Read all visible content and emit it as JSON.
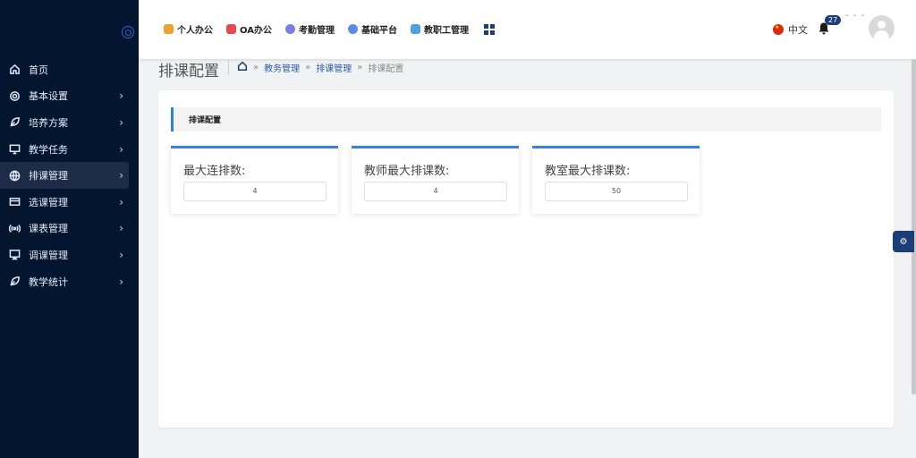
{
  "sidebar": {
    "items": [
      {
        "label": "首页",
        "icon": "home-icon",
        "has_children": false
      },
      {
        "label": "基本设置",
        "icon": "gear-icon",
        "has_children": true
      },
      {
        "label": "培养方案",
        "icon": "leaf-icon",
        "has_children": true
      },
      {
        "label": "教学任务",
        "icon": "monitor-icon",
        "has_children": true
      },
      {
        "label": "排课管理",
        "icon": "globe-icon",
        "has_children": true,
        "active": true
      },
      {
        "label": "选课管理",
        "icon": "card-icon",
        "has_children": true
      },
      {
        "label": "课表管理",
        "icon": "broadcast-icon",
        "has_children": true
      },
      {
        "label": "调课管理",
        "icon": "screen-icon",
        "has_children": true
      },
      {
        "label": "教学统计",
        "icon": "leaf-icon",
        "has_children": true
      }
    ],
    "chevron": "›"
  },
  "topnav": {
    "items": [
      {
        "label": "个人办公",
        "color": "#f0a030"
      },
      {
        "label": "OA办公",
        "color": "#e8484f"
      },
      {
        "label": "考勤管理",
        "color": "#7a7fe0"
      },
      {
        "label": "基础平台",
        "color": "#5b8de0"
      },
      {
        "label": "教职工管理",
        "color": "#4f9fe3"
      }
    ],
    "language": "中文",
    "notification_count": "27",
    "dots": "- - -"
  },
  "breadcrumb": {
    "page_title": "排课配置",
    "sep": "»",
    "items": [
      "教务管理",
      "排课管理",
      "排课配置"
    ]
  },
  "panel": {
    "section_title": "排课配置",
    "cards": [
      {
        "label": "最大连排数:",
        "value": "4"
      },
      {
        "label": "教师最大排课数:",
        "value": "4"
      },
      {
        "label": "教室最大排课数:",
        "value": "50"
      }
    ]
  },
  "colors": {
    "sidebar_bg": "#041530",
    "accent": "#3c7de4",
    "brand_dark": "#1c3e76"
  },
  "settings_icon": "⚙"
}
